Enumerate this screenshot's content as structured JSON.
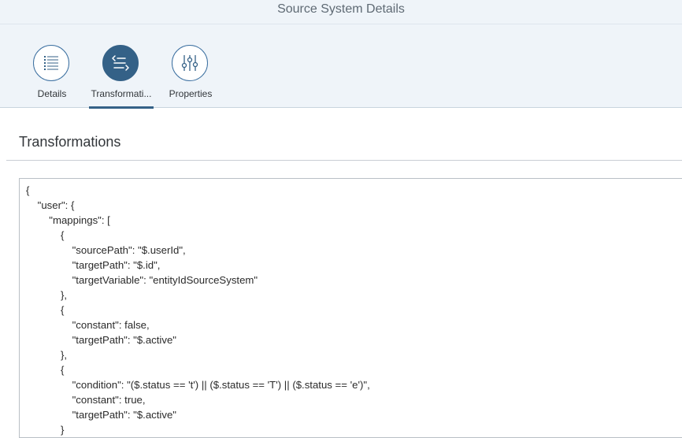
{
  "window": {
    "title": "Source System Details"
  },
  "tabs": [
    {
      "label": "Details",
      "icon": "list-icon",
      "selected": false
    },
    {
      "label": "Transformati...",
      "icon": "transform-icon",
      "selected": true
    },
    {
      "label": "Properties",
      "icon": "sliders-icon",
      "selected": false
    }
  ],
  "section": {
    "title": "Transformations"
  },
  "editor": {
    "content": "{\n    \"user\": {\n        \"mappings\": [\n            {\n                \"sourcePath\": \"$.userId\",\n                \"targetPath\": \"$.id\",\n                \"targetVariable\": \"entityIdSourceSystem\"\n            },\n            {\n                \"constant\": false,\n                \"targetPath\": \"$.active\"\n            },\n            {\n                \"condition\": \"($.status == 't') || ($.status == 'T') || ($.status == 'e')\",\n                \"constant\": true,\n                \"targetPath\": \"$.active\"\n            }"
  },
  "colors": {
    "accent": "#346187",
    "header_background": "#eff4f9"
  }
}
